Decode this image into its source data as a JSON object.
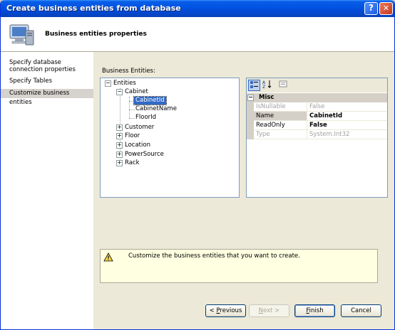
{
  "window": {
    "title": "Create business entities from database",
    "help_label": "?",
    "close_label": "✕"
  },
  "header": {
    "title": "Business entities properties",
    "logo_icon": "computer-icon"
  },
  "sidebar": {
    "items": [
      {
        "label_line1": "Specify database",
        "label_line2": "connection properties"
      },
      {
        "label": "Specify Tables"
      },
      {
        "label": "Customize business entities",
        "selected": true
      }
    ]
  },
  "main": {
    "entities_label": "Business Entities:",
    "tree": {
      "root": "Entities",
      "cabinet": "Cabinet",
      "cabinet_children": [
        "CabinetId",
        "CabinetName",
        "FloorId"
      ],
      "others": [
        "Customer",
        "Floor",
        "Location",
        "PowerSource",
        "Rack"
      ],
      "expand": "+",
      "collapse": "−"
    },
    "properties": {
      "category": "Misc",
      "rows": [
        {
          "name": "IsNullable",
          "value": "False",
          "disabled": true
        },
        {
          "name": "Name",
          "value": "CabinetId",
          "bold": true
        },
        {
          "name": "ReadOnly",
          "value": "False",
          "bold": true
        },
        {
          "name": "Type",
          "value": "System.Int32",
          "disabled": true
        }
      ]
    },
    "message": "Customize the business entities that you want to create."
  },
  "buttons": {
    "previous_prefix": "< ",
    "previous_key": "P",
    "previous_rest": "revious",
    "next_prefix": "",
    "next_key": "N",
    "next_rest": "ext >",
    "finish_key": "F",
    "finish_rest": "inish",
    "cancel": "Cancel"
  },
  "colors": {
    "titlebar": "#0054e3",
    "selection": "#316ac5",
    "message_bg": "#ffffe1"
  }
}
